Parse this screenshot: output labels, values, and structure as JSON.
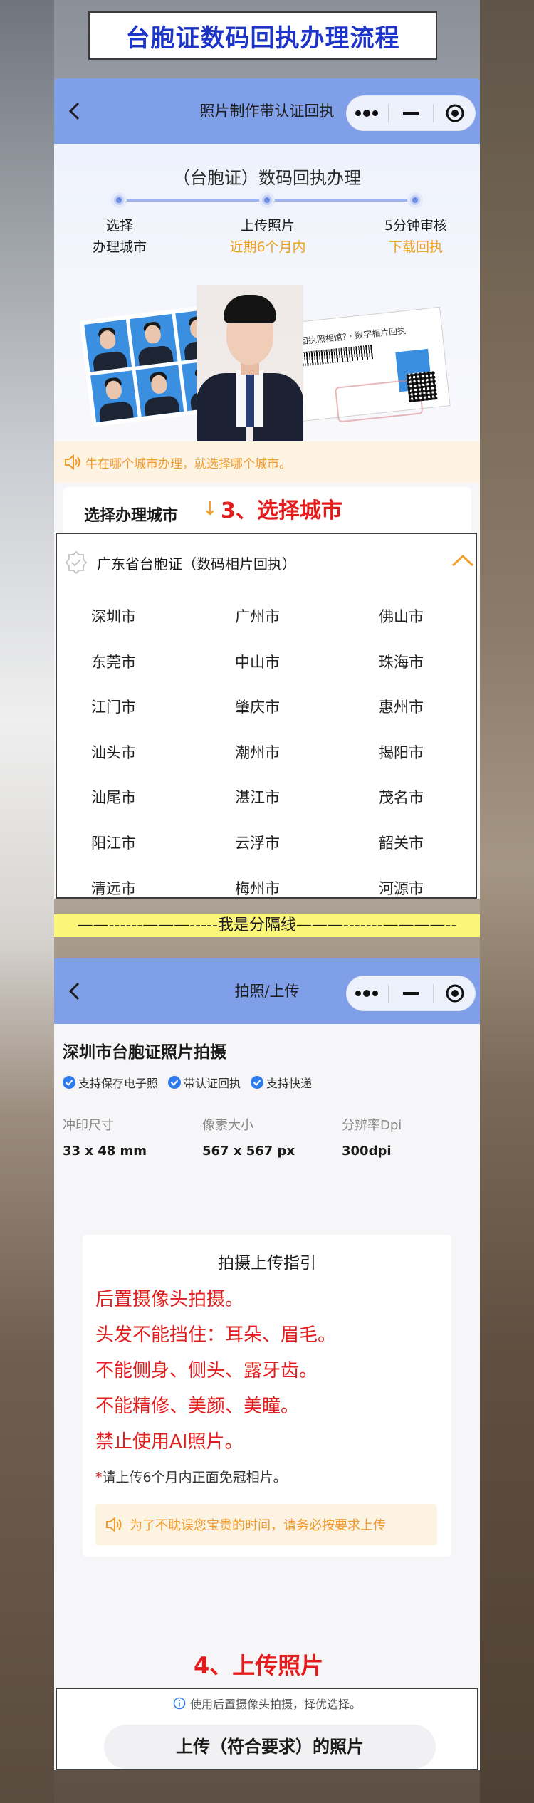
{
  "header": {
    "title": "台胞证数码回执办理流程"
  },
  "screen1": {
    "nav_title": "照片制作带认证回执",
    "heading": "（台胞证）数码回执办理",
    "steps": [
      {
        "line1": "选择",
        "line2": "办理城市"
      },
      {
        "line1": "上传照片",
        "line2": "近期6个月内"
      },
      {
        "line1": "5分钟审核",
        "line2": "下载回执"
      }
    ],
    "receipt_text": "回执照相馆? · 数字相片回执",
    "notice": "牛在哪个城市办理，就选择哪个城市。",
    "select_label": "选择办理城市",
    "select_arrow": "↓",
    "annotation": "3、选择城市",
    "province": "广东省台胞证（数码相片回执）",
    "cities": [
      "深圳市",
      "广州市",
      "佛山市",
      "东莞市",
      "中山市",
      "珠海市",
      "江门市",
      "肇庆市",
      "惠州市",
      "汕头市",
      "潮州市",
      "揭阳市",
      "汕尾市",
      "湛江市",
      "茂名市",
      "阳江市",
      "云浮市",
      "韶关市",
      "清远市",
      "梅州市",
      "河源市"
    ]
  },
  "separator": "——------———-----我是分隔线———-------————--",
  "screen2": {
    "nav_title": "拍照/上传",
    "title": "深圳市台胞证照片拍摄",
    "badges": [
      "支持保存电子照",
      "带认证回执",
      "支持快递"
    ],
    "specs": [
      {
        "label": "冲印尺寸",
        "value": "33 x 48 mm"
      },
      {
        "label": "像素大小",
        "value": "567 x 567 px"
      },
      {
        "label": "分辨率Dpi",
        "value": "300dpi"
      }
    ],
    "guide_title": "拍摄上传指引",
    "rules": [
      "后置摄像头拍摄。",
      "头发不能挡住：耳朵、眉毛。",
      "不能侧身、侧头、露牙齿。",
      "不能精修、美颜、美瞳。",
      "禁止使用AI照片。"
    ],
    "note_star": "*",
    "note": "请上传6个月内正面免冠相片。",
    "tip": "为了不耽误您宝贵的时间，请务必按要求上传",
    "annotation": "4、上传照片",
    "upload_hint": "使用后置摄像头拍摄，择优选择。",
    "upload_button": "上传（符合要求）的照片"
  },
  "colors": {
    "title_blue": "#1d34c9",
    "nav_blue": "#7f9fe9",
    "accent_orange": "#f0a21a",
    "annotation_red": "#e51b1b",
    "separator_yellow": "#fbf67a"
  }
}
